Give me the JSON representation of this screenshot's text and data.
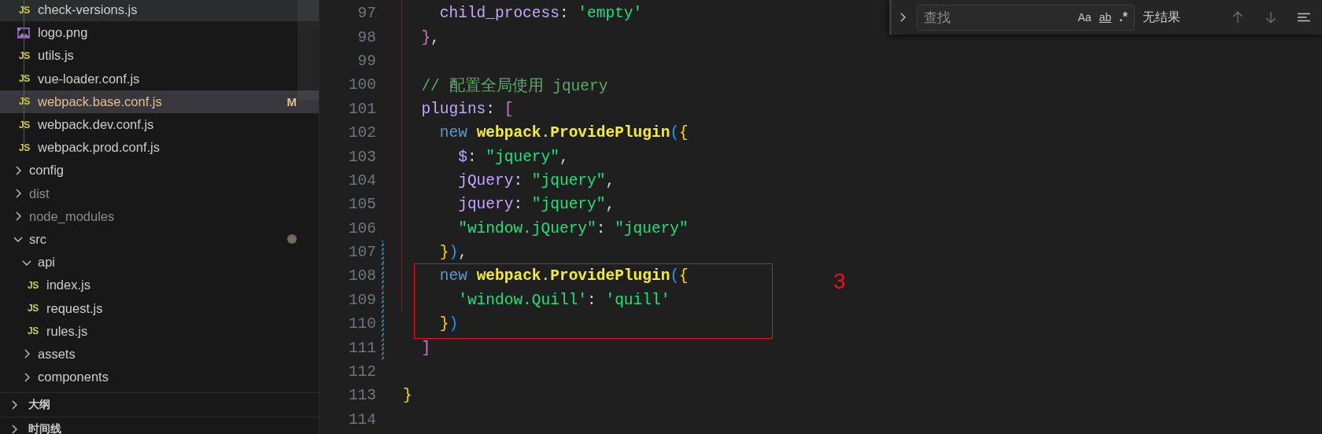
{
  "explorer": {
    "tree": [
      {
        "children": [
          {
            "label": "check-versions.js",
            "kind": "js",
            "icon_text": "JS",
            "selected": false,
            "hovered": true,
            "ignored": false
          },
          {
            "label": "logo.png",
            "kind": "image",
            "selected": false,
            "hovered": false,
            "ignored": false
          },
          {
            "label": "utils.js",
            "kind": "js",
            "icon_text": "JS",
            "selected": false,
            "hovered": false,
            "ignored": false
          },
          {
            "label": "vue-loader.conf.js",
            "kind": "js",
            "icon_text": "JS",
            "selected": false,
            "hovered": false,
            "ignored": false
          },
          {
            "label": "webpack.base.conf.js",
            "kind": "js",
            "icon_text": "JS",
            "selected": true,
            "hovered": false,
            "ignored": false,
            "badge": "M"
          },
          {
            "label": "webpack.dev.conf.js",
            "kind": "js",
            "icon_text": "JS",
            "selected": false,
            "hovered": false,
            "ignored": false
          },
          {
            "label": "webpack.prod.conf.js",
            "kind": "js",
            "icon_text": "JS",
            "selected": false,
            "hovered": false,
            "ignored": false
          }
        ]
      },
      {
        "label": "config",
        "kind": "folder",
        "expanded": false,
        "selected": false,
        "hovered": false,
        "ignored": false
      },
      {
        "label": "dist",
        "kind": "folder",
        "expanded": false,
        "selected": false,
        "hovered": false,
        "ignored": true
      },
      {
        "label": "node_modules",
        "kind": "folder",
        "expanded": false,
        "selected": false,
        "hovered": false,
        "ignored": true
      },
      {
        "label": "src",
        "kind": "folder",
        "expanded": true,
        "selected": false,
        "hovered": false,
        "ignored": false,
        "dot": true,
        "children": [
          {
            "label": "api",
            "kind": "folder",
            "expanded": true,
            "selected": false,
            "hovered": false,
            "ignored": false,
            "children": [
              {
                "label": "index.js",
                "kind": "js",
                "icon_text": "JS",
                "selected": false,
                "hovered": false,
                "ignored": false
              },
              {
                "label": "request.js",
                "kind": "js",
                "icon_text": "JS",
                "selected": false,
                "hovered": false,
                "ignored": false
              },
              {
                "label": "rules.js",
                "kind": "js",
                "icon_text": "JS",
                "selected": false,
                "hovered": false,
                "ignored": false
              }
            ]
          },
          {
            "label": "assets",
            "kind": "folder",
            "expanded": false,
            "selected": false,
            "hovered": false,
            "ignored": false
          },
          {
            "label": "components",
            "kind": "folder",
            "expanded": false,
            "selected": false,
            "hovered": false,
            "ignored": false
          }
        ]
      }
    ]
  },
  "panels": [
    {
      "label": "大纲",
      "expanded": false
    },
    {
      "label": "时间线",
      "expanded": false
    }
  ],
  "editor": {
    "lines": [
      {
        "number": "97",
        "modified": false,
        "boxed": false,
        "tokens": [
          {
            "kind": "property",
            "text": "    child_process"
          },
          {
            "kind": "punct",
            "text": ": "
          },
          {
            "kind": "string",
            "text": "'empty'"
          }
        ]
      },
      {
        "number": "98",
        "modified": false,
        "boxed": false,
        "tokens": [
          {
            "kind": "bracket",
            "text": "  }"
          },
          {
            "kind": "punct",
            "text": ","
          }
        ]
      },
      {
        "number": "99",
        "modified": false,
        "boxed": false
      },
      {
        "number": "100",
        "modified": false,
        "boxed": false,
        "tokens": [
          {
            "kind": "comment",
            "text": "  // 配置全局使用 jquery"
          }
        ]
      },
      {
        "number": "101",
        "modified": false,
        "boxed": false,
        "tokens": [
          {
            "kind": "property",
            "text": "  plugins"
          },
          {
            "kind": "punct",
            "text": ": "
          },
          {
            "kind": "bracket",
            "text": "["
          }
        ]
      },
      {
        "number": "102",
        "modified": false,
        "boxed": false,
        "tokens": [
          {
            "kind": "keyword",
            "text": "    new "
          },
          {
            "kind": "class",
            "text": "webpack"
          },
          {
            "kind": "punct",
            "text": "."
          },
          {
            "kind": "class",
            "text": "ProvidePlugin"
          },
          {
            "kind": "paren",
            "text": "("
          },
          {
            "kind": "brace",
            "text": "{"
          }
        ]
      },
      {
        "number": "103",
        "modified": false,
        "boxed": false,
        "tokens": [
          {
            "kind": "property",
            "text": "      $"
          },
          {
            "kind": "punct",
            "text": ": "
          },
          {
            "kind": "string",
            "text": "\"jquery\""
          },
          {
            "kind": "punct",
            "text": ","
          }
        ]
      },
      {
        "number": "104",
        "modified": false,
        "boxed": false,
        "tokens": [
          {
            "kind": "property",
            "text": "      jQuery"
          },
          {
            "kind": "punct",
            "text": ": "
          },
          {
            "kind": "string",
            "text": "\"jquery\""
          },
          {
            "kind": "punct",
            "text": ","
          }
        ]
      },
      {
        "number": "105",
        "modified": false,
        "boxed": false,
        "tokens": [
          {
            "kind": "property",
            "text": "      jquery"
          },
          {
            "kind": "punct",
            "text": ": "
          },
          {
            "kind": "string",
            "text": "\"jquery\""
          },
          {
            "kind": "punct",
            "text": ","
          }
        ]
      },
      {
        "number": "106",
        "modified": false,
        "boxed": false,
        "tokens": [
          {
            "kind": "string",
            "text": "      \"window.jQuery\""
          },
          {
            "kind": "punct",
            "text": ": "
          },
          {
            "kind": "string",
            "text": "\"jquery\""
          }
        ]
      },
      {
        "number": "107",
        "modified": true,
        "boxed": false,
        "tokens": [
          {
            "kind": "brace",
            "text": "    }"
          },
          {
            "kind": "paren",
            "text": ")"
          },
          {
            "kind": "punct",
            "text": ","
          }
        ]
      },
      {
        "number": "108",
        "modified": true,
        "boxed": true,
        "tokens": [
          {
            "kind": "keyword",
            "text": "    new "
          },
          {
            "kind": "class",
            "text": "webpack"
          },
          {
            "kind": "punct",
            "text": "."
          },
          {
            "kind": "class",
            "text": "ProvidePlugin"
          },
          {
            "kind": "paren",
            "text": "("
          },
          {
            "kind": "brace",
            "text": "{"
          }
        ]
      },
      {
        "number": "109",
        "modified": true,
        "boxed": true,
        "tokens": [
          {
            "kind": "string",
            "text": "      'window.Quill'"
          },
          {
            "kind": "punct",
            "text": ": "
          },
          {
            "kind": "string",
            "text": "'quill'"
          }
        ]
      },
      {
        "number": "110",
        "modified": true,
        "boxed": true,
        "tokens": [
          {
            "kind": "brace",
            "text": "    }"
          },
          {
            "kind": "paren",
            "text": ")"
          }
        ]
      },
      {
        "number": "111",
        "modified": true,
        "boxed": false,
        "tokens": [
          {
            "kind": "bracket",
            "text": "  ]"
          }
        ]
      },
      {
        "number": "112",
        "modified": false,
        "boxed": false
      },
      {
        "number": "113",
        "modified": false,
        "boxed": false,
        "tokens": [
          {
            "kind": "brace",
            "text": "}"
          }
        ]
      },
      {
        "number": "114",
        "modified": false,
        "boxed": false
      }
    ],
    "annotation": {
      "label": "3"
    }
  },
  "find_widget": {
    "placeholder": "查找",
    "options": [
      "Aa",
      "ab",
      ".*"
    ],
    "result": "无结果"
  }
}
